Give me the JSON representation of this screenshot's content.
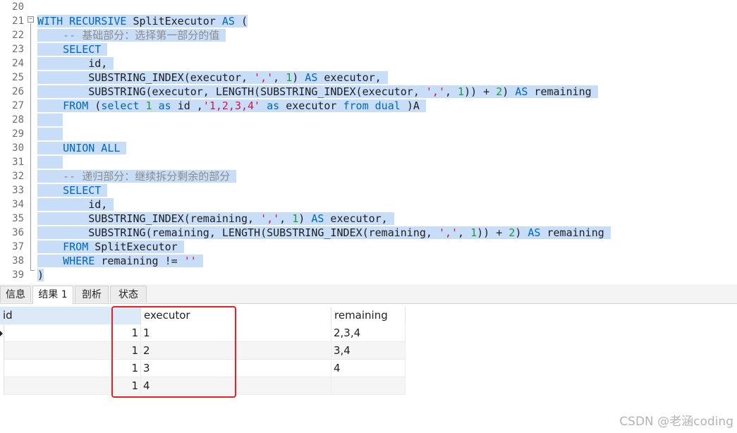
{
  "editor": {
    "line_numbers": [
      "20",
      "21",
      "22",
      "23",
      "24",
      "25",
      "26",
      "27",
      "28",
      "29",
      "30",
      "31",
      "32",
      "33",
      "34",
      "35",
      "36",
      "37",
      "38",
      "39"
    ],
    "lines": [
      [],
      [
        [
          "k",
          "WITH RECURSIVE "
        ],
        [
          "t",
          "SplitExecutor "
        ],
        [
          "k",
          "AS "
        ],
        [
          "t",
          "("
        ]
      ],
      [
        [
          "t",
          "    "
        ],
        [
          "c",
          "-- 基础部分：选择第一部分的值 "
        ]
      ],
      [
        [
          "t",
          "    "
        ],
        [
          "k",
          "SELECT "
        ]
      ],
      [
        [
          "t",
          "        id, "
        ]
      ],
      [
        [
          "t",
          "        SUBSTRING_INDEX(executor, "
        ],
        [
          "s",
          "','"
        ],
        [
          "t",
          ", "
        ],
        [
          "n",
          "1"
        ],
        [
          "t",
          ") "
        ],
        [
          "k",
          "AS "
        ],
        [
          "t",
          "executor, "
        ]
      ],
      [
        [
          "t",
          "        SUBSTRING(executor, LENGTH(SUBSTRING_INDEX(executor, "
        ],
        [
          "s",
          "','"
        ],
        [
          "t",
          ", "
        ],
        [
          "n",
          "1"
        ],
        [
          "t",
          ")) + "
        ],
        [
          "n",
          "2"
        ],
        [
          "t",
          ") "
        ],
        [
          "k",
          "AS "
        ],
        [
          "t",
          "remaining "
        ]
      ],
      [
        [
          "t",
          "    "
        ],
        [
          "k",
          "FROM "
        ],
        [
          "t",
          "("
        ],
        [
          "k",
          "select "
        ],
        [
          "n",
          "1 "
        ],
        [
          "k",
          "as "
        ],
        [
          "t",
          "id ,"
        ],
        [
          "s",
          "'1,2,3,4' "
        ],
        [
          "k",
          "as "
        ],
        [
          "t",
          "executor "
        ],
        [
          "k",
          "from dual "
        ],
        [
          "t",
          ")A "
        ]
      ],
      [
        [
          "t",
          "    "
        ]
      ],
      [
        [
          "t",
          "    "
        ]
      ],
      [
        [
          "t",
          "    "
        ],
        [
          "k",
          "UNION ALL "
        ]
      ],
      [
        [
          "t",
          "    "
        ]
      ],
      [
        [
          "t",
          "    "
        ],
        [
          "c",
          "-- 递归部分：继续拆分剩余的部分 "
        ]
      ],
      [
        [
          "t",
          "    "
        ],
        [
          "k",
          "SELECT "
        ]
      ],
      [
        [
          "t",
          "        id, "
        ]
      ],
      [
        [
          "t",
          "        SUBSTRING_INDEX(remaining, "
        ],
        [
          "s",
          "','"
        ],
        [
          "t",
          ", "
        ],
        [
          "n",
          "1"
        ],
        [
          "t",
          ") "
        ],
        [
          "k",
          "AS "
        ],
        [
          "t",
          "executor, "
        ]
      ],
      [
        [
          "t",
          "        SUBSTRING(remaining, LENGTH(SUBSTRING_INDEX(remaining, "
        ],
        [
          "s",
          "','"
        ],
        [
          "t",
          ", "
        ],
        [
          "n",
          "1"
        ],
        [
          "t",
          ")) + "
        ],
        [
          "n",
          "2"
        ],
        [
          "t",
          ") "
        ],
        [
          "k",
          "AS "
        ],
        [
          "t",
          "remaining "
        ]
      ],
      [
        [
          "t",
          "    "
        ],
        [
          "k",
          "FROM "
        ],
        [
          "t",
          "SplitExecutor "
        ]
      ],
      [
        [
          "t",
          "    "
        ],
        [
          "k",
          "WHERE "
        ],
        [
          "t",
          "remaining != "
        ],
        [
          "s",
          "'' "
        ]
      ],
      [
        [
          "t",
          ")"
        ]
      ]
    ]
  },
  "tabs": {
    "info": "信息",
    "result1": "结果 1",
    "profile": "剖析",
    "status": "状态"
  },
  "grid": {
    "columns": {
      "id": "id",
      "executor": "executor",
      "remaining": "remaining"
    },
    "rows": [
      {
        "id": "1",
        "executor": "1",
        "remaining": "2,3,4"
      },
      {
        "id": "1",
        "executor": "2",
        "remaining": "3,4"
      },
      {
        "id": "1",
        "executor": "3",
        "remaining": "4"
      },
      {
        "id": "1",
        "executor": "4",
        "remaining": ""
      }
    ]
  },
  "watermark": "CSDN @老涵coding",
  "colors": {
    "keyword": "#0067c0",
    "comment": "#8c8c8c",
    "string": "#d4134b",
    "number": "#1a9a3a",
    "selection": "#c8ddf7",
    "highlight_box": "#e8201f"
  }
}
